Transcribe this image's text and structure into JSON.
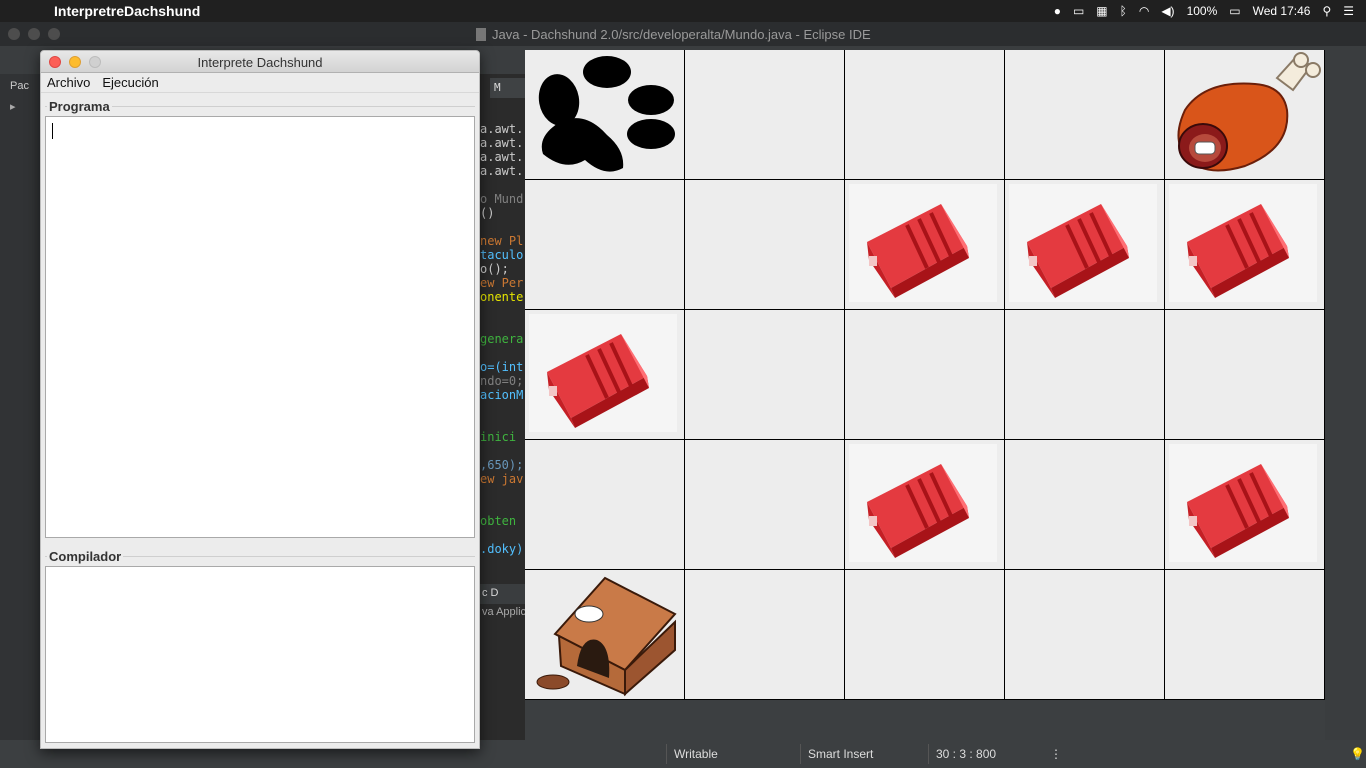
{
  "menubar": {
    "app_name": "InterpretreDachshund",
    "battery": "100%",
    "clock": "Wed 17:46"
  },
  "eclipse": {
    "window_title": "Java - Dachshund 2.0/src/developeralta/Mundo.java - Eclipse IDE",
    "left_view_label": "Pac",
    "editor_tab": "M",
    "code_lines": [
      {
        "text": "a.awt.",
        "color": "#cccccc"
      },
      {
        "text": "a.awt.",
        "color": "#cccccc"
      },
      {
        "text": "a.awt.",
        "color": "#cccccc"
      },
      {
        "text": "a.awt.",
        "color": "#cccccc"
      },
      {
        "text": "o Mund",
        "color": "#808080"
      },
      {
        "text": "()",
        "color": "#cccccc"
      },
      {
        "text": "new Pl",
        "color": "#cc7832"
      },
      {
        "text": "taculo",
        "color": "#52c0ff"
      },
      {
        "text": "o();",
        "color": "#cccccc"
      },
      {
        "text": "ew Per",
        "color": "#cc7832"
      },
      {
        "text": "onente",
        "color": "#e6e600"
      },
      {
        "text": "genera",
        "color": "#3fb43f"
      },
      {
        "text": "o=(int",
        "color": "#52c0ff"
      },
      {
        "text": "ndo=0;",
        "color": "#808080"
      },
      {
        "text": "acionM",
        "color": "#52c0ff"
      },
      {
        "text": " inici",
        "color": "#3fb43f"
      },
      {
        "text": ",650);",
        "color": "#6897bb"
      },
      {
        "text": "ew jav",
        "color": "#cc7832"
      },
      {
        "text": " obten",
        "color": "#3fb43f"
      },
      {
        "text": ".doky)",
        "color": "#52c0ff"
      }
    ],
    "console_tabs": "c  D",
    "console_sub": "va Applic",
    "status": {
      "writable": "Writable",
      "insert_mode": "Smart Insert",
      "position": "30 : 3 : 800"
    }
  },
  "interpreter": {
    "title": "Interprete Dachshund",
    "menu": [
      "Archivo",
      "Ejecución"
    ],
    "program_label": "Programa",
    "compiler_label": "Compilador"
  },
  "world": {
    "rows": 5,
    "cols": 5,
    "cells": [
      [
        "paw",
        "empty",
        "empty",
        "empty",
        "meat"
      ],
      [
        "empty",
        "empty",
        "barrier",
        "barrier",
        "barrier"
      ],
      [
        "barrier",
        "empty",
        "empty",
        "empty",
        "empty"
      ],
      [
        "empty",
        "empty",
        "barrier",
        "empty",
        "barrier"
      ],
      [
        "doghouse",
        "empty",
        "empty",
        "empty",
        "empty"
      ]
    ]
  },
  "colors": {
    "barrier": "#d8262e",
    "meat": "#d9551a",
    "doghouse": "#b56a3a"
  }
}
